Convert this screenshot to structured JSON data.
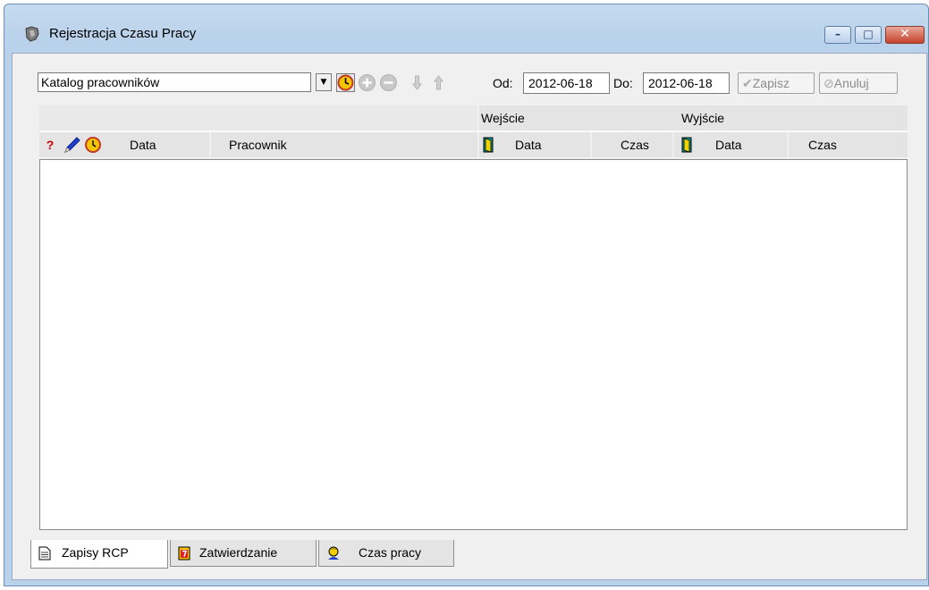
{
  "window": {
    "title": "Rejestracja Czasu Pracy",
    "minimize_glyph": "–",
    "maximize_glyph": "□",
    "close_glyph": "✕"
  },
  "toolbar": {
    "combo_value": "Katalog pracowników",
    "combo_arrow": "▼",
    "od_label": "Od:",
    "od_value": "2012-06-18",
    "do_label": "Do:",
    "do_value": "2012-06-18",
    "save_label": "Zapisz",
    "cancel_label": "Anuluj"
  },
  "grid": {
    "group_headers": [
      "Wejście",
      "Wyjście"
    ],
    "columns": {
      "flag": "?",
      "date": "Data",
      "employee": "Pracownik",
      "entry_date": "Data",
      "entry_time": "Czas",
      "exit_date": "Data",
      "exit_time": "Czas"
    },
    "rows": []
  },
  "tabs": [
    {
      "label": "Zapisy RCP",
      "icon": "document-icon",
      "active": true
    },
    {
      "label": "Zatwierdzanie",
      "icon": "calendar-icon",
      "active": false
    },
    {
      "label": "Czas pracy",
      "icon": "person-icon",
      "active": false
    }
  ],
  "colors": {
    "title_bar": "#b9d1ea",
    "close_button": "#c4412a",
    "question_mark": "#cc0000",
    "clock": "#f5c400"
  }
}
